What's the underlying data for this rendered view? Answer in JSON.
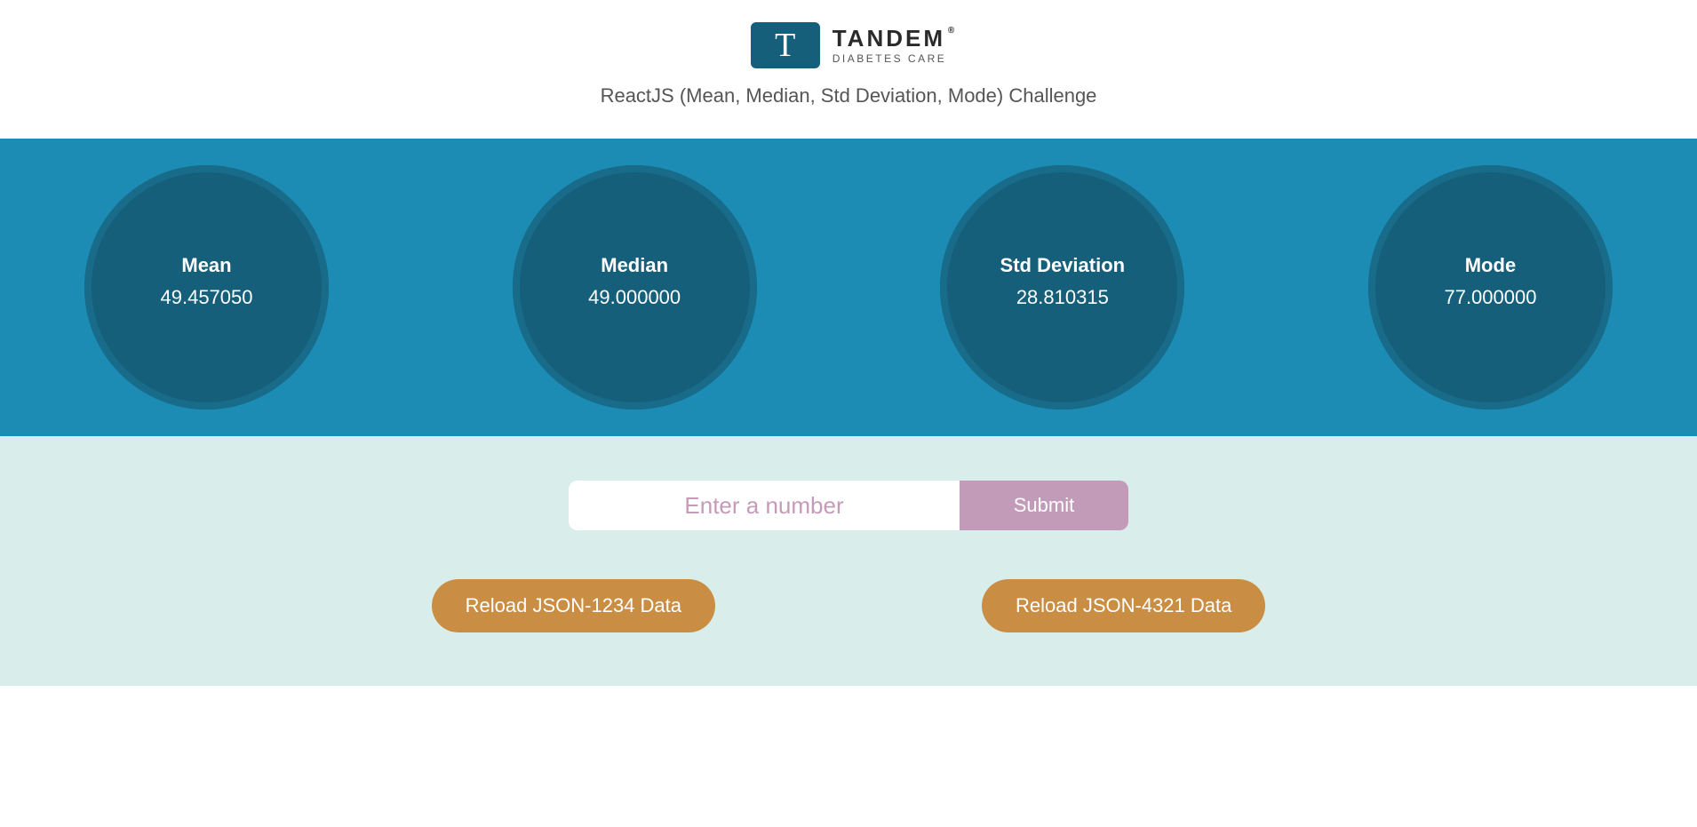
{
  "header": {
    "logo_main": "TANDEM",
    "logo_sub": "DIABETES CARE",
    "subtitle": "ReactJS (Mean, Median, Std Deviation, Mode) Challenge"
  },
  "stats": [
    {
      "label": "Mean",
      "value": "49.457050"
    },
    {
      "label": "Median",
      "value": "49.000000"
    },
    {
      "label": "Std Deviation",
      "value": "28.810315"
    },
    {
      "label": "Mode",
      "value": "77.000000"
    }
  ],
  "controls": {
    "input_placeholder": "Enter a number",
    "submit_label": "Submit",
    "reload1_label": "Reload JSON-1234 Data",
    "reload2_label": "Reload JSON-4321 Data"
  }
}
